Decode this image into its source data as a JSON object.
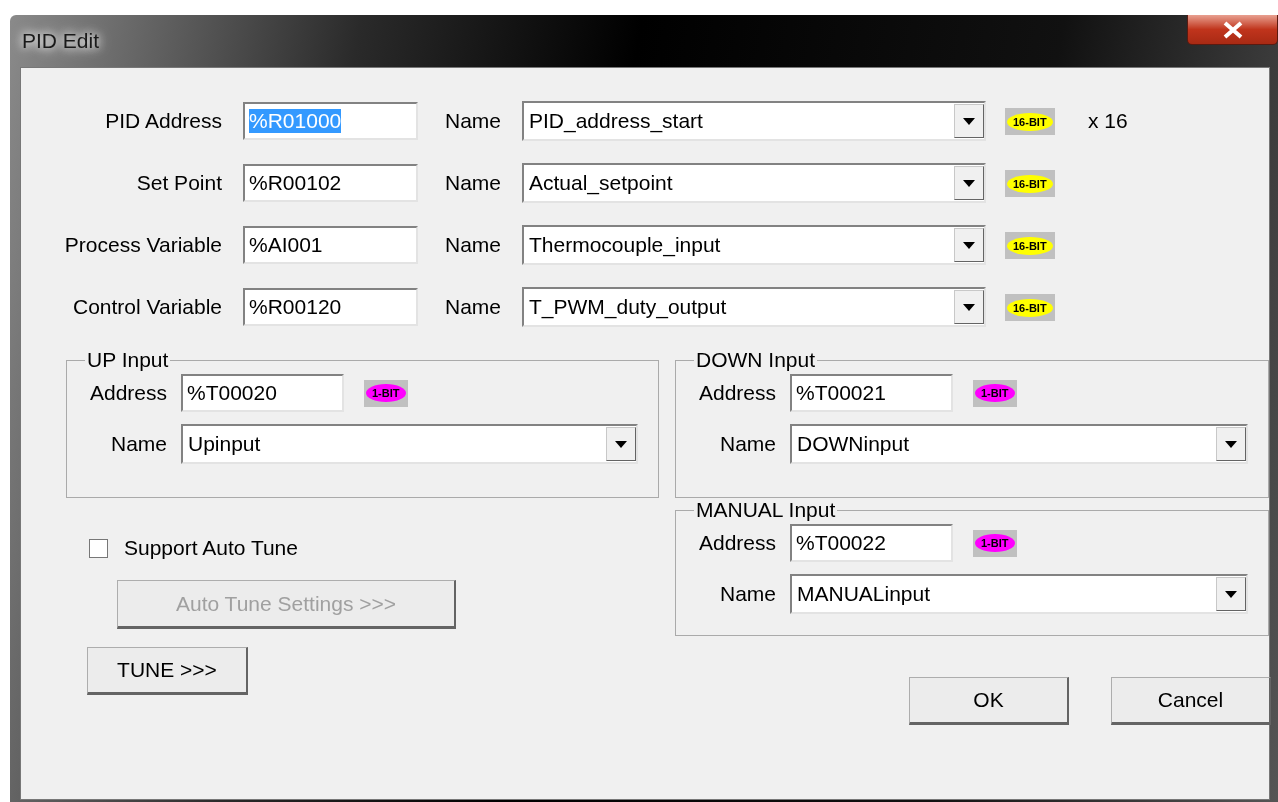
{
  "window": {
    "title": "PID Edit"
  },
  "main_fields": [
    {
      "label": "PID Address",
      "address": "%R01000",
      "address_selected": true,
      "name_label": "Name",
      "name": "PID_address_start",
      "badge": {
        "text": "16-BIT",
        "color": "#ffff00"
      },
      "count": "x 16"
    },
    {
      "label": "Set Point",
      "address": "%R00102",
      "address_selected": false,
      "name_label": "Name",
      "name": "Actual_setpoint",
      "badge": {
        "text": "16-BIT",
        "color": "#ffff00"
      }
    },
    {
      "label": "Process Variable",
      "address": "%AI001",
      "address_selected": false,
      "name_label": "Name",
      "name": "Thermocouple_input",
      "badge": {
        "text": "16-BIT",
        "color": "#ffff00"
      }
    },
    {
      "label": "Control Variable",
      "address": "%R00120",
      "address_selected": false,
      "name_label": "Name",
      "name": "T_PWM_duty_output",
      "badge": {
        "text": "16-BIT",
        "color": "#ffff00"
      }
    }
  ],
  "groups": [
    {
      "title": "UP Input",
      "address_label": "Address",
      "address": "%T00020",
      "badge": {
        "text": "1-BIT",
        "color": "#ff00ff"
      },
      "name_label": "Name",
      "name": "Upinput"
    },
    {
      "title": "DOWN Input",
      "address_label": "Address",
      "address": "%T00021",
      "badge": {
        "text": "1-BIT",
        "color": "#ff00ff"
      },
      "name_label": "Name",
      "name": "DOWNinput"
    },
    {
      "title": "MANUAL Input",
      "address_label": "Address",
      "address": "%T00022",
      "badge": {
        "text": "1-BIT",
        "color": "#ff00ff"
      },
      "name_label": "Name",
      "name": "MANUALinput"
    }
  ],
  "auto_tune": {
    "label": "Support Auto Tune",
    "checked": false
  },
  "tune_buttons": [
    {
      "label": "Auto Tune Settings >>>",
      "disabled": true
    },
    {
      "label": "TUNE >>>",
      "disabled": false
    }
  ],
  "dialog_buttons": [
    "OK",
    "Cancel"
  ]
}
